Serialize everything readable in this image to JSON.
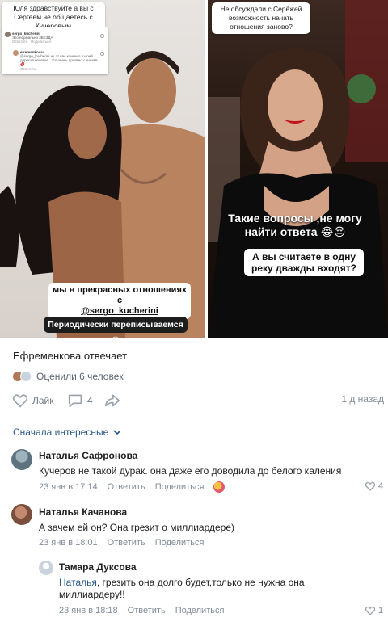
{
  "stories": {
    "left": {
      "question": "Юля здравствуйте а вы с Сергеем не общаетесь с Кучеровым",
      "caption": "мы в прекрасных отношениях с",
      "handle": "@sergo_kucherini",
      "caption2": "Периодически переписываемся 😔"
    },
    "right": {
      "question": "Не обсуждали с Серёжей возможность начать отношения заново?",
      "caption": "Такие вопросы ,не могу найти ответа 😂😔",
      "caption2": "А вы считаете в одну реку дважды входят?"
    },
    "mini_comments": {
      "user1": "sergo_kucherini",
      "text1": "Это нормально 3ВЕЗДА",
      "reply1": "Ответить",
      "share1": "Поделиться",
      "user2": "efremenkovaa",
      "text2": "@sergo_kucherini ну от вас конечно в моей дорогой нелепке ..это очень приятно слышать 💋",
      "reply2": "Ответить"
    }
  },
  "post": {
    "author_line": "Ефременкова отвечает",
    "rated": "Оценили 6 человек",
    "like_label": "Лайк",
    "comments_count": "4",
    "time": "1 д назад"
  },
  "sort_label": "Сначала интересные",
  "colors": {
    "link": "#2a5885",
    "meta": "#818c99",
    "text": "#222222"
  },
  "comments": [
    {
      "name": "Наталья Сафронова",
      "text": "Кучеров не такой дурак. она даже его доводила до белого каления",
      "date": "23 янв в 17:14",
      "reply": "Ответить",
      "share": "Поделиться",
      "likes": "4"
    },
    {
      "name": "Наталья Качанова",
      "text": "А зачем ей он? Она грезит о миллиардере)",
      "date": "23 янв в 18:01",
      "reply": "Ответить",
      "share": "Поделиться"
    },
    {
      "name": "Тамара Дуксова",
      "mention": "Наталья",
      "text": ", грезить она долго будет,только не нужна она миллиардеру!!",
      "date": "23 янв в 18:18",
      "reply": "Ответить",
      "share": "Поделиться",
      "likes": "1"
    }
  ]
}
